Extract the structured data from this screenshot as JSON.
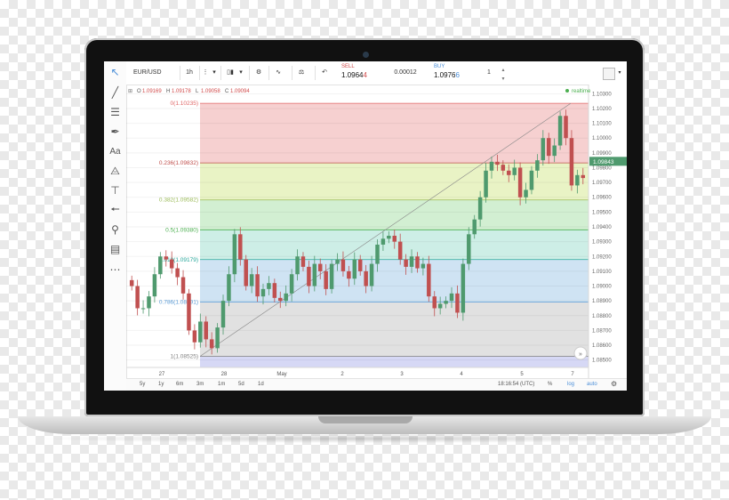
{
  "toolbar": {
    "symbol": "EUR/USD",
    "interval": "1h",
    "sell_label": "SELL",
    "sell_price_main": "1.0964",
    "sell_price_last": "4",
    "spread": "0.00012",
    "buy_label": "BUY",
    "buy_price_main": "1.0976",
    "buy_price_last": "6",
    "quantity": "1"
  },
  "ohlc": {
    "o_label": "O",
    "o_value": "1.09169",
    "h_label": "H",
    "h_value": "1.09178",
    "l_label": "L",
    "l_value": "1.09058",
    "c_label": "C",
    "c_value": "1.09094"
  },
  "realtime_label": "realtime",
  "fib_levels": [
    {
      "label": "0(1.10235)",
      "price": 1.10235,
      "line_color": "#e06666",
      "zone_color": "#f6d0d0"
    },
    {
      "label": "0.236(1.09832)",
      "price": 1.09832,
      "line_color": "#c0504d",
      "zone_color": "#e9f3c5"
    },
    {
      "label": "0.382(1.09582)",
      "price": 1.09582,
      "line_color": "#9bbb59",
      "zone_color": "#d2efd2"
    },
    {
      "label": "0.5(1.09380)",
      "price": 1.0938,
      "line_color": "#4caf50",
      "zone_color": "#cdeee6"
    },
    {
      "label": "0.618(1.09179)",
      "price": 1.09179,
      "line_color": "#26a69a",
      "zone_color": "#cfe3f3"
    },
    {
      "label": "0.786(1.08891)",
      "price": 1.08891,
      "line_color": "#5b9bd5",
      "zone_color": "#e1e1e1"
    },
    {
      "label": "1(1.08525)",
      "price": 1.08525,
      "line_color": "#7f7f7f",
      "zone_color": "#d6d8f5"
    }
  ],
  "price_badge": "1.09843",
  "bottom_bar": {
    "ranges": [
      "5y",
      "1y",
      "6m",
      "3m",
      "1m",
      "5d",
      "1d"
    ],
    "clock": "18:16:54 (UTC)",
    "percent": "%",
    "log": "log",
    "auto": "auto"
  },
  "chart_data": {
    "type": "candlestick",
    "symbol": "EUR/USD",
    "interval": "1h",
    "x_tick_labels": [
      "27",
      "28",
      "May",
      "2",
      "3",
      "4",
      "5",
      "7"
    ],
    "y_tick_labels": [
      "1.10300",
      "1.10200",
      "1.10100",
      "1.10000",
      "1.09900",
      "1.09800",
      "1.09700",
      "1.09600",
      "1.09500",
      "1.09400",
      "1.09300",
      "1.09200",
      "1.09100",
      "1.09000",
      "1.08900",
      "1.08800",
      "1.08700",
      "1.08600",
      "1.08500"
    ],
    "ylim": [
      1.0845,
      1.1035
    ],
    "close_path": [
      1.09,
      1.0885,
      1.0885,
      1.0893,
      1.0908,
      1.092,
      1.0918,
      1.0912,
      1.0906,
      1.0895,
      1.087,
      1.0862,
      1.0876,
      1.0864,
      1.0858,
      1.0872,
      1.089,
      1.0908,
      1.0935,
      1.0918,
      1.09,
      1.0908,
      1.0893,
      1.0898,
      1.0902,
      1.0892,
      1.089,
      1.0895,
      1.0908,
      1.092,
      1.0913,
      1.09,
      1.0915,
      1.091,
      1.0898,
      1.0915,
      1.0918,
      1.091,
      1.0905,
      1.0918,
      1.091,
      1.09,
      1.0915,
      1.0928,
      1.0932,
      1.0934,
      1.093,
      1.0918,
      1.0913,
      1.092,
      1.0912,
      1.0915,
      1.0893,
      1.0885,
      1.0888,
      1.089,
      1.0895,
      1.0882,
      1.0915,
      1.0935,
      1.0945,
      1.096,
      1.0978,
      1.0984,
      1.0982,
      1.0978,
      1.0975,
      1.098,
      1.096,
      1.0965,
      1.0978,
      1.0985,
      1.1,
      1.0988,
      1.0995,
      1.1015,
      1.1,
      1.0968,
      1.0975,
      1.0973
    ],
    "fibonacci_retracement": {
      "levels": [
        0,
        0.236,
        0.382,
        0.5,
        0.618,
        0.786,
        1
      ],
      "prices": [
        1.10235,
        1.09832,
        1.09582,
        1.0938,
        1.09179,
        1.08891,
        1.08525
      ]
    },
    "current_price": 1.09843
  }
}
